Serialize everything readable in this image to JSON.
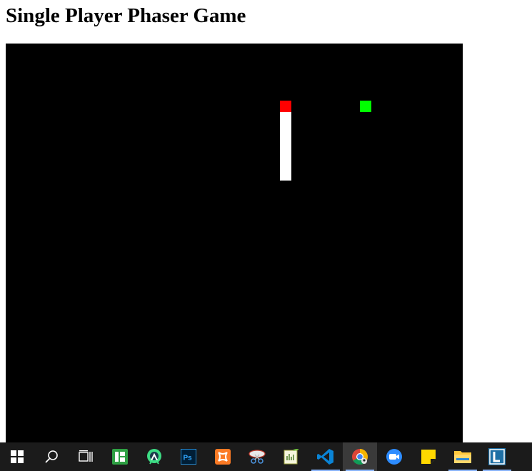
{
  "page": {
    "title": "Single Player Phaser Game"
  },
  "game": {
    "background_color": "#000000",
    "snake_head_color": "#ff0000",
    "snake_body_color": "#ffffff",
    "food_color": "#00ff00"
  },
  "taskbar": {
    "background_color": "#1b1b1b",
    "items": [
      {
        "icon": "windows-start-icon"
      },
      {
        "icon": "search-icon"
      },
      {
        "icon": "task-view-icon"
      },
      {
        "icon": "app-grid-green-icon"
      },
      {
        "icon": "android-studio-icon"
      },
      {
        "icon": "photoshop-icon"
      },
      {
        "icon": "xampp-icon"
      },
      {
        "icon": "snipping-tool-icon"
      },
      {
        "icon": "notepad-plus-plus-icon"
      },
      {
        "icon": "vscode-icon",
        "running": true
      },
      {
        "icon": "chrome-icon",
        "active": true
      },
      {
        "icon": "zoom-icon"
      },
      {
        "icon": "sticky-notes-icon"
      },
      {
        "icon": "file-explorer-icon",
        "running": true
      },
      {
        "icon": "lightworks-icon",
        "running": true
      }
    ]
  }
}
